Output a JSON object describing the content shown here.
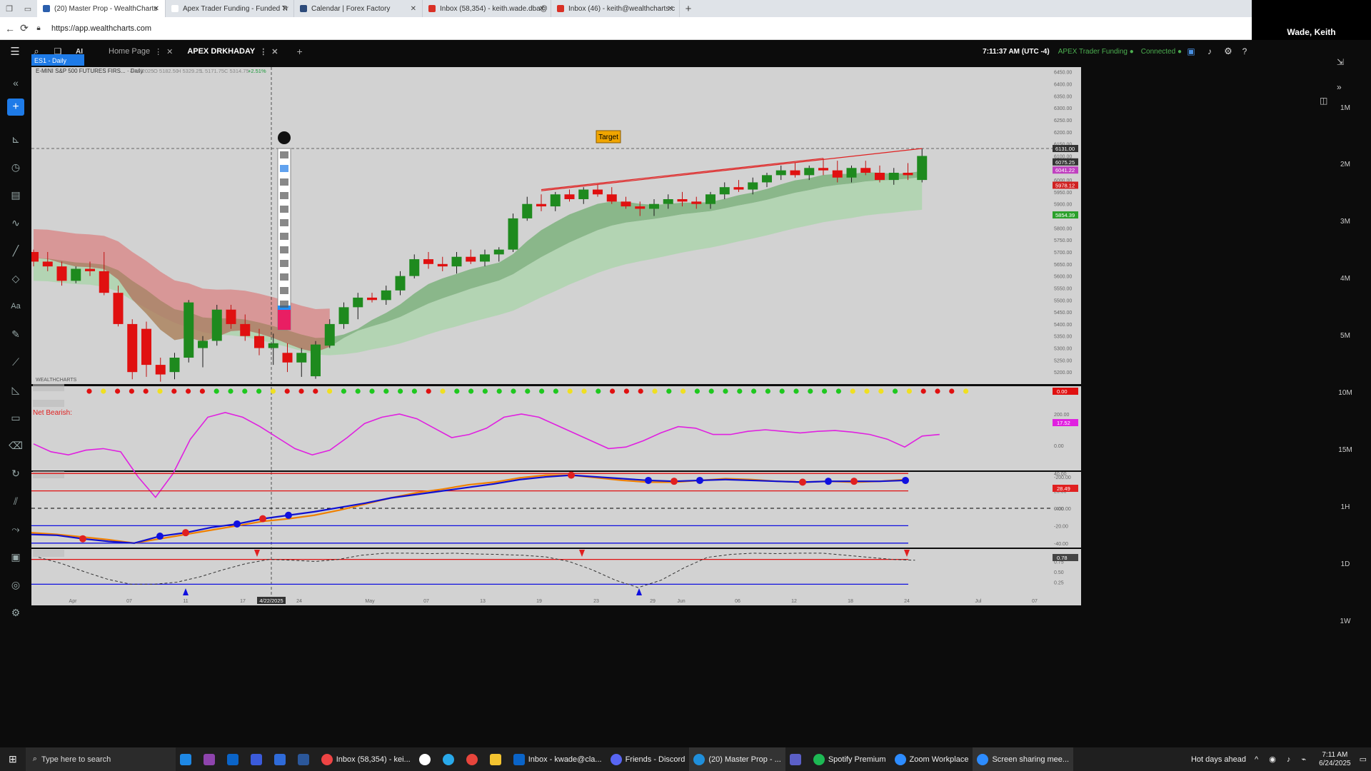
{
  "browser": {
    "tabs": [
      {
        "label": "(20) Master Prop - WealthCharts",
        "active": true,
        "color": "#2b5fad"
      },
      {
        "label": "Apex Trader Funding - Funded Tr",
        "active": false,
        "color": "#ffffff"
      },
      {
        "label": "Calendar | Forex Factory",
        "active": false,
        "color": "#2c4a7a"
      },
      {
        "label": "Inbox (58,354) - keith.wade.dba@",
        "active": false,
        "color": "#d93025"
      },
      {
        "label": "Inbox (46) - keith@wealthcharts.c",
        "active": false,
        "color": "#d93025"
      }
    ],
    "url": "https://app.wealthcharts.com"
  },
  "zoom": {
    "participant": "Wade, Keith"
  },
  "app": {
    "tabs": [
      {
        "label": "Home Page",
        "active": false
      },
      {
        "label": "APEX DRKHADAY",
        "active": true
      }
    ],
    "clock": "7:11:37 AM",
    "tz": "(UTC -4)",
    "account": "APEX Trader Funding",
    "status": "Connected"
  },
  "chart": {
    "symbol_tab": "ES1 - Daily",
    "header": "E-MINI S&P 500 FUTURES FIRS... · Daily",
    "ohlc": {
      "date": "4/22/2025",
      "o": "O 5182.50",
      "h": "H 5329.25",
      "l": "L 5171.75",
      "c": "C 5314.75",
      "chg": "+2.51%"
    },
    "annotation": "Target",
    "logo": "WEALTHCHARTS",
    "net_label": "Net Bearish:",
    "crosshair_date": "4/22/2025",
    "price_ticks": [
      "6450.00",
      "6400.00",
      "6350.00",
      "6300.00",
      "6250.00",
      "6200.00",
      "6150.00",
      "6100.00",
      "6050.00",
      "6000.00",
      "5950.00",
      "5900.00",
      "5850.00",
      "5800.00",
      "5750.00",
      "5700.00",
      "5650.00",
      "5600.00",
      "5550.00",
      "5500.00",
      "5450.00",
      "5400.00",
      "5350.00",
      "5300.00",
      "5250.00",
      "5200.00"
    ],
    "price_tags": [
      {
        "label": "6131.00",
        "color": "#333333"
      },
      {
        "label": "6075.25",
        "color": "#333333"
      },
      {
        "label": "6041.22",
        "color": "#c040c0"
      },
      {
        "label": "5978.12",
        "color": "#d02020"
      },
      {
        "label": "5854.39",
        "color": "#2aa02a"
      }
    ],
    "dots_tag": "0.00",
    "osc_ticks": [
      "200.00",
      "0.00",
      "-200.00",
      "-400.00"
    ],
    "osc_tag": "17.52",
    "dmi_ticks": [
      "40.00",
      "20.00",
      "0.00",
      "-20.00",
      "-40.00"
    ],
    "dmi_tag": "28.49",
    "stoch_ticks": [
      "0.75",
      "0.50",
      "0.25"
    ],
    "stoch_tag": "0.78",
    "x_labels": [
      "Apr",
      "07",
      "11",
      "17",
      "24",
      "May",
      "07",
      "13",
      "19",
      "23",
      "29",
      "Jun",
      "06",
      "12",
      "18",
      "24",
      "Jul",
      "07"
    ],
    "right_tf": [
      "1M",
      "2M",
      "3M",
      "4M",
      "5M",
      "10M",
      "15M",
      "1H",
      "1D",
      "1W"
    ]
  },
  "chart_data": {
    "type": "candlestick",
    "title": "E-MINI S&P 500 FUTURES FIRS... · Daily",
    "ylim": [
      5150,
      6470
    ],
    "ohlc": [
      [
        5700,
        5710,
        5640,
        5660
      ],
      [
        5660,
        5700,
        5620,
        5640
      ],
      [
        5640,
        5660,
        5560,
        5580
      ],
      [
        5580,
        5640,
        5570,
        5630
      ],
      [
        5630,
        5660,
        5600,
        5620
      ],
      [
        5620,
        5700,
        5520,
        5530
      ],
      [
        5530,
        5560,
        5390,
        5400
      ],
      [
        5400,
        5420,
        5170,
        5200
      ],
      [
        5380,
        5410,
        5180,
        5230
      ],
      [
        5230,
        5260,
        5160,
        5190
      ],
      [
        5200,
        5280,
        5170,
        5260
      ],
      [
        5260,
        5500,
        5240,
        5490
      ],
      [
        5300,
        5350,
        5220,
        5330
      ],
      [
        5330,
        5480,
        5310,
        5460
      ],
      [
        5460,
        5480,
        5380,
        5400
      ],
      [
        5400,
        5440,
        5330,
        5350
      ],
      [
        5350,
        5380,
        5270,
        5300
      ],
      [
        5300,
        5360,
        5230,
        5320
      ],
      [
        5280,
        5320,
        5200,
        5240
      ],
      [
        5240,
        5300,
        5180,
        5280
      ],
      [
        5182.5,
        5329.25,
        5171.75,
        5314.75
      ],
      [
        5310,
        5420,
        5300,
        5400
      ],
      [
        5400,
        5490,
        5380,
        5470
      ],
      [
        5470,
        5530,
        5420,
        5510
      ],
      [
        5510,
        5530,
        5490,
        5500
      ],
      [
        5500,
        5560,
        5480,
        5540
      ],
      [
        5540,
        5620,
        5520,
        5600
      ],
      [
        5600,
        5690,
        5590,
        5670
      ],
      [
        5670,
        5700,
        5630,
        5650
      ],
      [
        5650,
        5680,
        5620,
        5640
      ],
      [
        5640,
        5700,
        5610,
        5680
      ],
      [
        5680,
        5710,
        5650,
        5660
      ],
      [
        5660,
        5710,
        5640,
        5690
      ],
      [
        5690,
        5720,
        5660,
        5710
      ],
      [
        5710,
        5860,
        5700,
        5840
      ],
      [
        5840,
        5930,
        5830,
        5900
      ],
      [
        5900,
        5940,
        5870,
        5890
      ],
      [
        5890,
        5950,
        5870,
        5940
      ],
      [
        5940,
        5960,
        5910,
        5920
      ],
      [
        5920,
        5970,
        5900,
        5960
      ],
      [
        5960,
        5980,
        5930,
        5940
      ],
      [
        5940,
        5970,
        5900,
        5910
      ],
      [
        5910,
        5930,
        5880,
        5890
      ],
      [
        5890,
        5910,
        5850,
        5880
      ],
      [
        5880,
        5920,
        5850,
        5900
      ],
      [
        5900,
        5940,
        5880,
        5920
      ],
      [
        5920,
        5950,
        5890,
        5910
      ],
      [
        5910,
        5930,
        5880,
        5900
      ],
      [
        5900,
        5950,
        5880,
        5940
      ],
      [
        5940,
        5990,
        5920,
        5970
      ],
      [
        5970,
        6000,
        5950,
        5960
      ],
      [
        5960,
        6010,
        5940,
        5990
      ],
      [
        5990,
        6030,
        5970,
        6020
      ],
      [
        6020,
        6060,
        6000,
        6040
      ],
      [
        6040,
        6070,
        6010,
        6020
      ],
      [
        6020,
        6060,
        6000,
        6050
      ],
      [
        6050,
        6090,
        6020,
        6040
      ],
      [
        6040,
        6080,
        5990,
        6010
      ],
      [
        6010,
        6060,
        5990,
        6050
      ],
      [
        6050,
        6080,
        6020,
        6030
      ],
      [
        6030,
        6060,
        5990,
        6000
      ],
      [
        6000,
        6050,
        5980,
        6030
      ],
      [
        6030,
        6070,
        6000,
        6020
      ],
      [
        6000,
        6131,
        5990,
        6100
      ]
    ],
    "signal_dots": [
      "r",
      "y",
      "r",
      "r",
      "r",
      "y",
      "r",
      "r",
      "r",
      "g",
      "g",
      "g",
      "g",
      "y",
      "r",
      "r",
      "r",
      "y",
      "g",
      "g",
      "g",
      "g",
      "g",
      "g",
      "r",
      "y",
      "g",
      "g",
      "g",
      "g",
      "g",
      "g",
      "g",
      "g",
      "y",
      "y",
      "g",
      "r",
      "r",
      "r",
      "y",
      "g",
      "y",
      "g",
      "g",
      "g",
      "g",
      "g",
      "g",
      "g",
      "g",
      "g",
      "g",
      "g",
      "y",
      "y",
      "y",
      "g",
      "y",
      "r",
      "r",
      "r",
      "y"
    ],
    "oscillator": [
      10,
      -40,
      -60,
      -30,
      -20,
      -40,
      -200,
      -330,
      -180,
      40,
      180,
      210,
      180,
      120,
      50,
      -20,
      -60,
      -30,
      50,
      140,
      180,
      200,
      170,
      110,
      50,
      70,
      110,
      180,
      200,
      180,
      130,
      80,
      30,
      -20,
      -10,
      30,
      80,
      120,
      110,
      70,
      70,
      90,
      100,
      90,
      80,
      90,
      95,
      85,
      70,
      40,
      -10,
      60,
      70
    ],
    "dmi_red": [
      -28,
      -30,
      -33,
      -36,
      -40,
      -35,
      -30,
      -25,
      -20,
      -15,
      -12,
      -8,
      -2,
      5,
      12,
      18,
      22,
      27,
      30,
      35,
      38,
      38,
      35,
      32,
      30,
      30,
      32,
      34,
      33,
      31,
      30,
      31,
      30,
      31,
      33
    ],
    "dmi_blue": [
      -30,
      -31,
      -35,
      -38,
      -40,
      -32,
      -28,
      -22,
      -18,
      -12,
      -8,
      -4,
      1,
      6,
      12,
      16,
      20,
      24,
      28,
      33,
      36,
      38,
      36,
      34,
      32,
      31,
      32,
      33,
      32,
      31,
      30,
      31,
      31,
      31,
      32
    ],
    "stoch": [
      0.85,
      0.7,
      0.5,
      0.32,
      0.2,
      0.2,
      0.25,
      0.38,
      0.55,
      0.7,
      0.8,
      0.78,
      0.75,
      0.8,
      0.9,
      0.95,
      0.95,
      0.94,
      0.95,
      0.93,
      0.92,
      0.9,
      0.86,
      0.75,
      0.55,
      0.3,
      0.12,
      0.3,
      0.6,
      0.85,
      0.92,
      0.95,
      0.94,
      0.95,
      0.95,
      0.9,
      0.85,
      0.8,
      0.78
    ]
  }
}
